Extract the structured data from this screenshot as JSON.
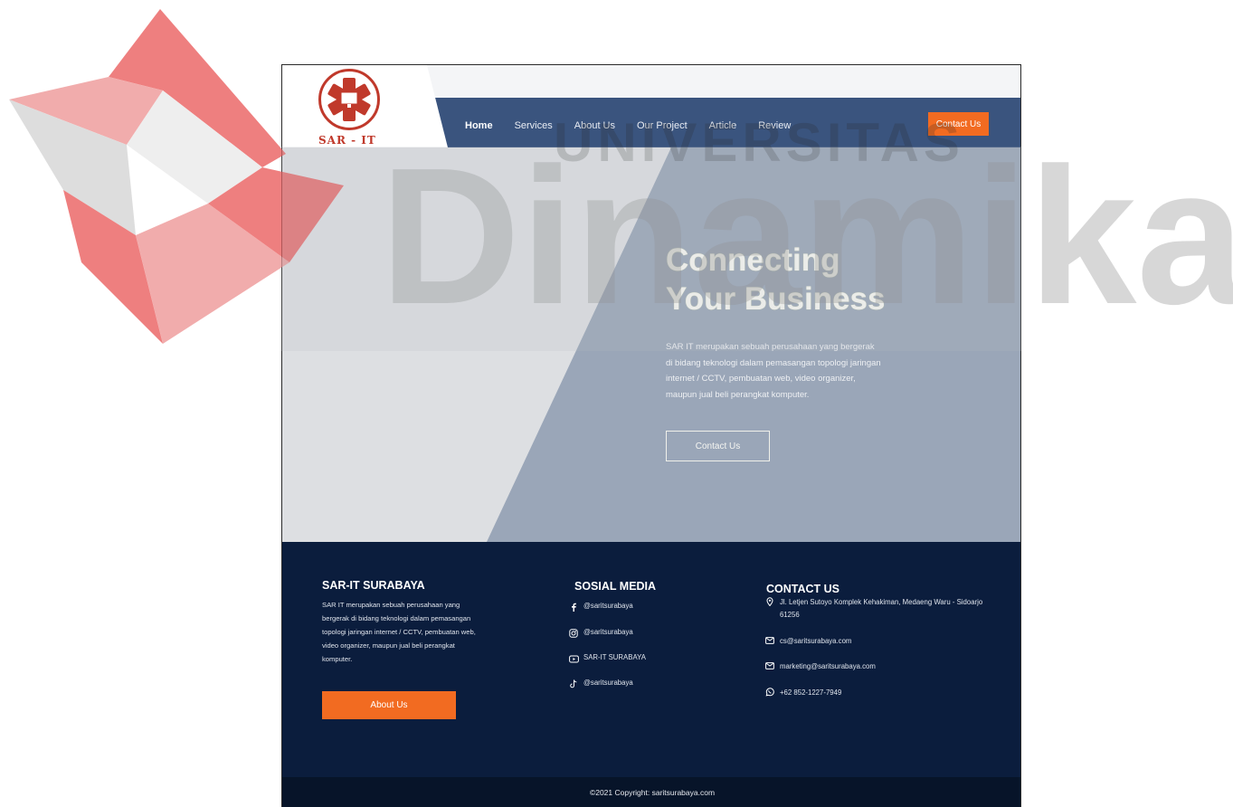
{
  "brand": {
    "logo_text": "SAR - IT",
    "colors": {
      "logo_red": "#c0392b",
      "nav_blue": "#3a547e",
      "accent_orange": "#f26b21",
      "footer_navy": "#0b1d3d"
    }
  },
  "nav": {
    "items": [
      {
        "label": "Home",
        "active": true
      },
      {
        "label": "Services",
        "active": false
      },
      {
        "label": "About Us",
        "active": false
      },
      {
        "label": "Our Project",
        "active": false
      },
      {
        "label": "Article",
        "active": false
      },
      {
        "label": "Review",
        "active": false
      }
    ],
    "cta_label": "Contact Us"
  },
  "hero": {
    "title_line1": "Connecting",
    "title_line2": "Your Business",
    "description": "SAR IT merupakan sebuah perusahaan yang bergerak di bidang teknologi dalam pemasangan topologi jaringan internet / CCTV, pembuatan web, video organizer, maupun jual beli perangkat komputer.",
    "button_label": "Contact Us"
  },
  "footer": {
    "about": {
      "heading": "SAR-IT SURABAYA",
      "text": "SAR IT merupakan sebuah perusahaan yang bergerak di bidang teknologi dalam pemasangan topologi jaringan internet / CCTV, pembuatan web, video organizer, maupun jual beli perangkat komputer.",
      "button_label": "About Us"
    },
    "social": {
      "heading": "SOSIAL MEDIA",
      "items": [
        {
          "icon": "facebook-icon",
          "label": "@saritsurabaya"
        },
        {
          "icon": "instagram-icon",
          "label": "@saritsurabaya"
        },
        {
          "icon": "youtube-icon",
          "label": "SAR-IT SURABAYA"
        },
        {
          "icon": "tiktok-icon",
          "label": "@saritsurabaya"
        }
      ]
    },
    "contact": {
      "heading": "CONTACT US",
      "items": [
        {
          "icon": "location-pin-icon",
          "label": "Jl. Letjen Sutoyo Komplek Kehakiman, Medaeng Waru - Sidoarjo 61256"
        },
        {
          "icon": "mail-icon",
          "label": "cs@saritsurabaya.com"
        },
        {
          "icon": "mail-icon",
          "label": "marketing@saritsurabaya.com"
        },
        {
          "icon": "whatsapp-icon",
          "label": "+62 852-1227-7949"
        }
      ]
    },
    "copyright": "©2021 Copyright: saritsurabaya.com"
  },
  "watermark": {
    "top_word": "UNIVERSITAS",
    "main_word": "Dinamika"
  }
}
